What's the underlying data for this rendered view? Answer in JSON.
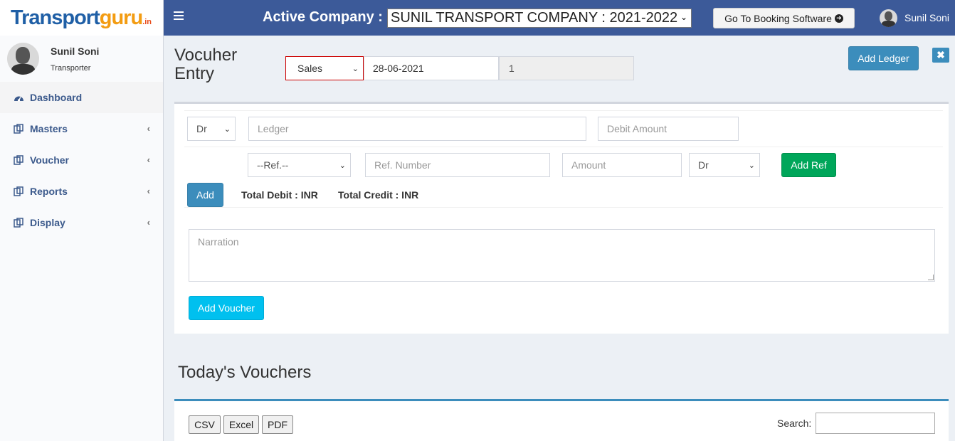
{
  "brand": {
    "part1": "Transport",
    "part2": "guru",
    "part3": ".in"
  },
  "user": {
    "name": "Sunil Soni",
    "role": "Transporter"
  },
  "sidebar": {
    "items": [
      {
        "label": "Dashboard",
        "icon": "dashboard-icon"
      },
      {
        "label": "Masters",
        "icon": "copy-icon"
      },
      {
        "label": "Voucher",
        "icon": "copy-icon"
      },
      {
        "label": "Reports",
        "icon": "copy-icon"
      },
      {
        "label": "Display",
        "icon": "copy-icon"
      }
    ]
  },
  "header": {
    "company_label": "Active Company :",
    "company_value": "SUNIL TRANSPORT COMPANY : 2021-2022",
    "booking_button": "Go To Booking Software",
    "user_name": "Sunil Soni"
  },
  "page": {
    "title": "Vocuher Entry",
    "voucher_type": "Sales",
    "date": "28-06-2021",
    "voucher_no": "1",
    "add_ledger": "Add Ledger"
  },
  "entry": {
    "drcr": "Dr",
    "ledger_placeholder": "Ledger",
    "amount_placeholder": "Debit Amount",
    "ref_select": "--Ref.--",
    "ref_number_placeholder": "Ref. Number",
    "ref_amount_placeholder": "Amount",
    "ref_drcr": "Dr",
    "add_ref": "Add Ref",
    "add": "Add",
    "total_debit": "Total Debit :  INR",
    "total_credit": "Total Credit :  INR",
    "narration_placeholder": "Narration",
    "add_voucher": "Add Voucher"
  },
  "vouchers": {
    "title": "Today's Vouchers",
    "buttons": [
      "CSV",
      "Excel",
      "PDF"
    ],
    "search_label": "Search:"
  }
}
